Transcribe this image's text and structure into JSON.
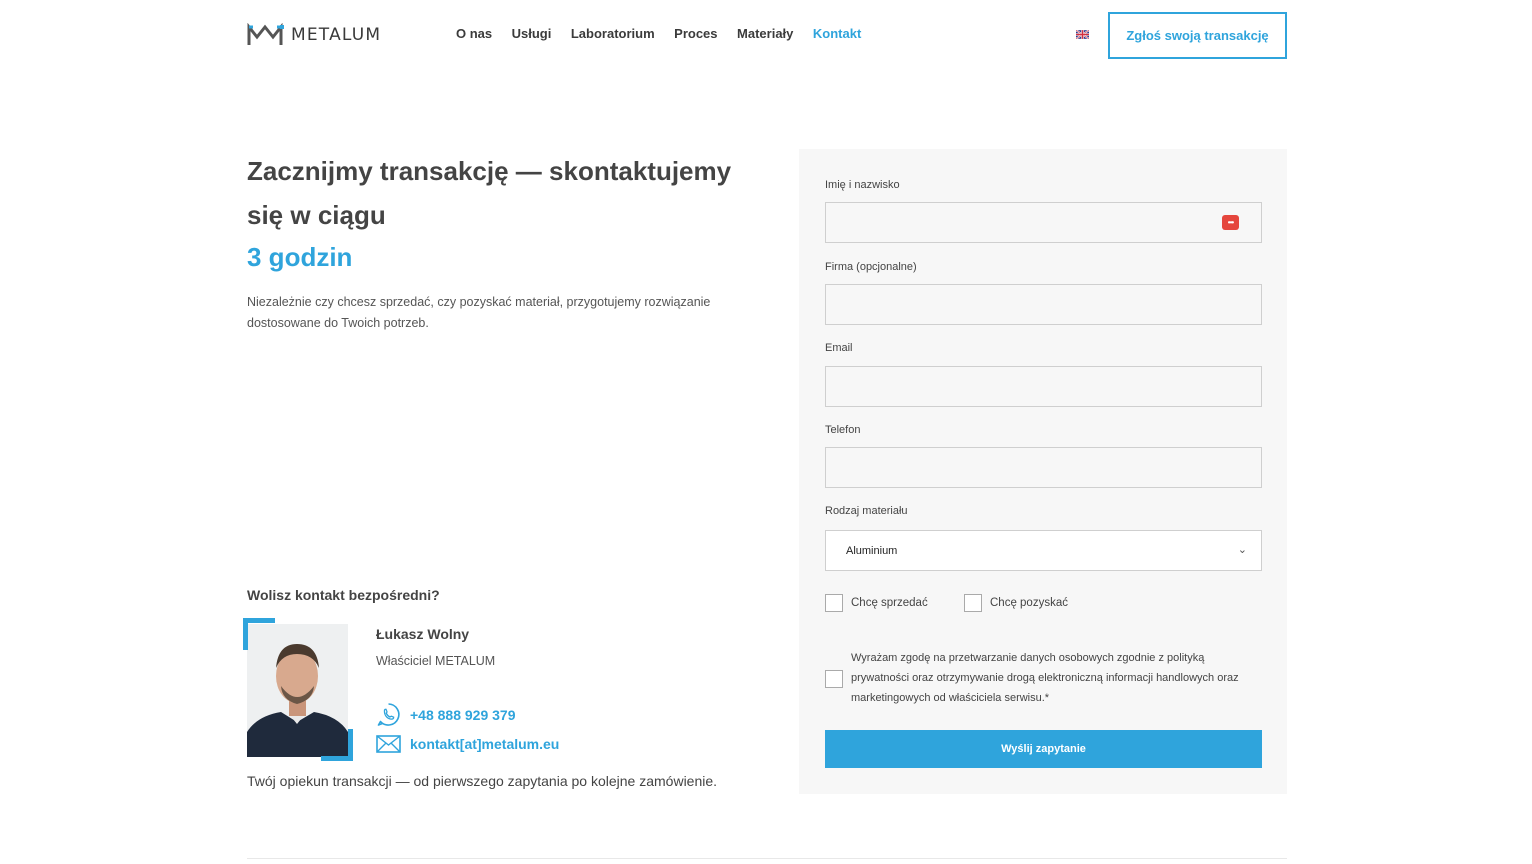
{
  "header": {
    "logo_text": "METALUM",
    "nav": [
      "O nas",
      "Usługi",
      "Laboratorium",
      "Proces",
      "Materiały",
      "Kontakt"
    ],
    "active_nav": "Kontakt",
    "cta_label": "Zgłoś swoją transakcję",
    "language_flag": "uk-flag-icon"
  },
  "hero": {
    "headline": "Zacznijmy transakcję — skontaktujemy się w ciągu",
    "headline_accent": "3 godzin",
    "lead": "Niezależnie czy chcesz sprzedać, czy pozyskać materiał, przygotujemy rozwiązanie dostosowane do Twoich potrzeb."
  },
  "direct_contact": {
    "title": "Wolisz kontakt bezpośredni?",
    "name": "Łukasz Wolny",
    "role": "Właściciel METALUM",
    "phone": "+48 888 929 379",
    "email": "kontakt[at]metalum.eu",
    "tagline": "Twój opiekun transakcji — od pierwszego zapytania po kolejne zamówienie."
  },
  "form": {
    "name_label": "Imię i nazwisko",
    "name_value": "",
    "company_label": "Firma (opcjonalne)",
    "company_value": "",
    "email_label": "Email",
    "email_value": "",
    "phone_label": "Telefon",
    "phone_value": "",
    "material_label": "Rodzaj materiału",
    "material_value": "Aluminium",
    "sell_label": "Chcę sprzedać",
    "acquire_label": "Chcę pozyskać",
    "consent_text": "Wyrażam zgodę na przetwarzanie danych osobowych zgodnie z polityką prywatności oraz otrzymywanie drogą elektroniczną informacji handlowych oraz marketingowych od właściciela serwisu.*",
    "submit_label": "Wyślij zapytanie"
  },
  "colors": {
    "accent": "#2fa4dc",
    "text": "#444444",
    "form_bg": "#f7f7f7"
  }
}
